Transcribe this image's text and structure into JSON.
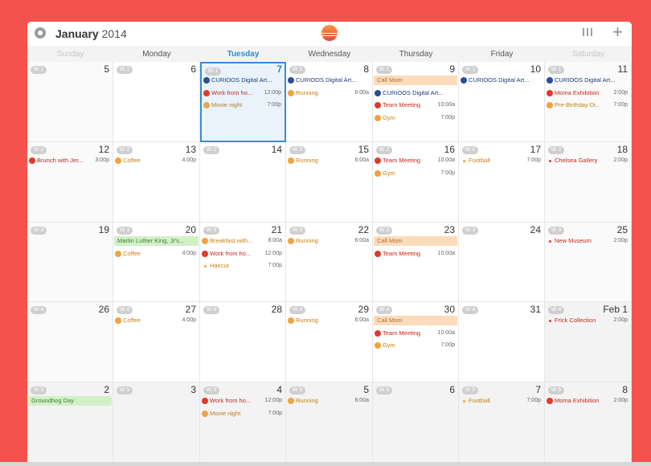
{
  "header": {
    "month": "January",
    "year": " 2014",
    "settings_icon": "gear-icon",
    "logo_icon": "sunrise-logo-icon",
    "view_icon": "columns-view-icon",
    "add_icon": "plus-icon",
    "add_label": "+"
  },
  "weekdays": [
    {
      "label": "Sunday",
      "style": "weekend"
    },
    {
      "label": "Monday",
      "style": ""
    },
    {
      "label": "Tuesday",
      "style": "today"
    },
    {
      "label": "Wednesday",
      "style": ""
    },
    {
      "label": "Thursday",
      "style": ""
    },
    {
      "label": "Friday",
      "style": ""
    },
    {
      "label": "Saturday",
      "style": "weekend"
    }
  ],
  "weeks": [
    {
      "badge": "W 1",
      "days": [
        {
          "num": "5",
          "events": []
        },
        {
          "num": "6",
          "events": []
        },
        {
          "num": "7",
          "today": true,
          "events": [
            {
              "name": "CURIOOS Digital Art...",
              "time": "",
              "color": "blue",
              "kind": "icon"
            },
            {
              "name": "Work from ho...",
              "time": "12:00p",
              "color": "red",
              "kind": "icon"
            },
            {
              "name": "Movie night",
              "time": "7:00p",
              "color": "brown",
              "kind": "icon"
            }
          ]
        },
        {
          "num": "8",
          "events": [
            {
              "name": "CURIOOS Digital Art...",
              "time": "",
              "color": "blue",
              "kind": "icon"
            },
            {
              "name": "Running",
              "time": "6:00a",
              "color": "orange",
              "kind": "icon"
            }
          ]
        },
        {
          "num": "9",
          "events": [
            {
              "name": "Call Mom",
              "time": "",
              "color": "peach",
              "kind": "allday"
            },
            {
              "name": "CURIOOS Digital Art...",
              "time": "",
              "color": "blue",
              "kind": "icon"
            },
            {
              "name": "Team Meeting",
              "time": "10:00a",
              "color": "red",
              "kind": "icon"
            },
            {
              "name": "Gym",
              "time": "7:00p",
              "color": "orange",
              "kind": "icon"
            }
          ]
        },
        {
          "num": "10",
          "events": [
            {
              "name": "CURIOOS Digital Art...",
              "time": "",
              "color": "blue",
              "kind": "icon"
            }
          ]
        },
        {
          "num": "11",
          "events": [
            {
              "name": "CURIOOS Digital Art...",
              "time": "",
              "color": "blue",
              "kind": "icon"
            },
            {
              "name": "Moma Exhibition",
              "time": "2:00p",
              "color": "red",
              "kind": "icon"
            },
            {
              "name": "Pre-Birthday Di...",
              "time": "7:00p",
              "color": "orange",
              "kind": "icon"
            }
          ]
        }
      ]
    },
    {
      "badge": "W 2",
      "days": [
        {
          "num": "12",
          "events": [
            {
              "name": "Brunch with Jer...",
              "time": "3:00p",
              "color": "red",
              "kind": "icon"
            }
          ]
        },
        {
          "num": "13",
          "events": [
            {
              "name": "Coffee",
              "time": "4:00p",
              "color": "orange",
              "kind": "icon"
            }
          ]
        },
        {
          "num": "14",
          "events": []
        },
        {
          "num": "15",
          "events": [
            {
              "name": "Running",
              "time": "6:00a",
              "color": "orange",
              "kind": "icon"
            }
          ]
        },
        {
          "num": "16",
          "events": [
            {
              "name": "Team Meeting",
              "time": "10:00a",
              "color": "red",
              "kind": "icon"
            },
            {
              "name": "Gym",
              "time": "7:00p",
              "color": "orange",
              "kind": "icon"
            }
          ]
        },
        {
          "num": "17",
          "events": [
            {
              "name": "Football",
              "time": "7:00p",
              "color": "orange",
              "kind": "dot"
            }
          ]
        },
        {
          "num": "18",
          "events": [
            {
              "name": "Chelsea Gallery",
              "time": "2:00p",
              "color": "red",
              "kind": "dot"
            }
          ]
        }
      ]
    },
    {
      "badge": "W 3",
      "days": [
        {
          "num": "19",
          "events": []
        },
        {
          "num": "20",
          "events": [
            {
              "name": "Martin Luther King, Jr's...",
              "time": "",
              "color": "green",
              "kind": "allday"
            },
            {
              "name": "Coffee",
              "time": "4:00p",
              "color": "orange",
              "kind": "icon"
            }
          ]
        },
        {
          "num": "21",
          "events": [
            {
              "name": "Breakfast with...",
              "time": "8:00a",
              "color": "orange",
              "kind": "icon"
            },
            {
              "name": "Work from ho...",
              "time": "12:00p",
              "color": "red",
              "kind": "icon"
            },
            {
              "name": "Haircut",
              "time": "7:00p",
              "color": "orange",
              "kind": "dot"
            }
          ]
        },
        {
          "num": "22",
          "events": [
            {
              "name": "Running",
              "time": "6:00a",
              "color": "orange",
              "kind": "icon"
            }
          ]
        },
        {
          "num": "23",
          "events": [
            {
              "name": "Call Mom",
              "time": "",
              "color": "peach",
              "kind": "allday"
            },
            {
              "name": "Team Meeting",
              "time": "10:00a",
              "color": "red",
              "kind": "icon"
            }
          ]
        },
        {
          "num": "24",
          "events": []
        },
        {
          "num": "25",
          "events": [
            {
              "name": "New Museum",
              "time": "2:00p",
              "color": "red",
              "kind": "dot"
            }
          ]
        }
      ]
    },
    {
      "badge": "W 4",
      "days": [
        {
          "num": "26",
          "events": []
        },
        {
          "num": "27",
          "events": [
            {
              "name": "Coffee",
              "time": "4:00p",
              "color": "orange",
              "kind": "icon"
            }
          ]
        },
        {
          "num": "28",
          "events": []
        },
        {
          "num": "29",
          "events": [
            {
              "name": "Running",
              "time": "6:00a",
              "color": "orange",
              "kind": "icon"
            }
          ]
        },
        {
          "num": "30",
          "events": [
            {
              "name": "Call Mom",
              "time": "",
              "color": "peach",
              "kind": "allday"
            },
            {
              "name": "Team Meeting",
              "time": "10:00a",
              "color": "red",
              "kind": "icon"
            },
            {
              "name": "Gym",
              "time": "7:00p",
              "color": "orange",
              "kind": "icon"
            }
          ]
        },
        {
          "num": "31",
          "events": []
        },
        {
          "num": "Feb 1",
          "gray": true,
          "events": [
            {
              "name": "Frick Collection",
              "time": "2:00p",
              "color": "red",
              "kind": "dot"
            }
          ]
        }
      ]
    },
    {
      "badge": "W 5",
      "days": [
        {
          "num": "2",
          "gray": true,
          "events": [
            {
              "name": "Groundhog Day",
              "time": "",
              "color": "green",
              "kind": "allday"
            }
          ]
        },
        {
          "num": "3",
          "gray": true,
          "events": []
        },
        {
          "num": "4",
          "gray": true,
          "events": [
            {
              "name": "Work from ho...",
              "time": "12:00p",
              "color": "red",
              "kind": "icon"
            },
            {
              "name": "Movie night",
              "time": "7:00p",
              "color": "brown",
              "kind": "icon"
            }
          ]
        },
        {
          "num": "5",
          "gray": true,
          "events": [
            {
              "name": "Running",
              "time": "6:00a",
              "color": "orange",
              "kind": "icon"
            }
          ]
        },
        {
          "num": "6",
          "gray": true,
          "events": []
        },
        {
          "num": "7",
          "gray": true,
          "events": [
            {
              "name": "Football",
              "time": "7:00p",
              "color": "orange",
              "kind": "dot"
            }
          ]
        },
        {
          "num": "8",
          "gray": true,
          "events": [
            {
              "name": "Moma Exhibition",
              "time": "2:00p",
              "color": "red",
              "kind": "icon"
            }
          ]
        }
      ]
    }
  ]
}
